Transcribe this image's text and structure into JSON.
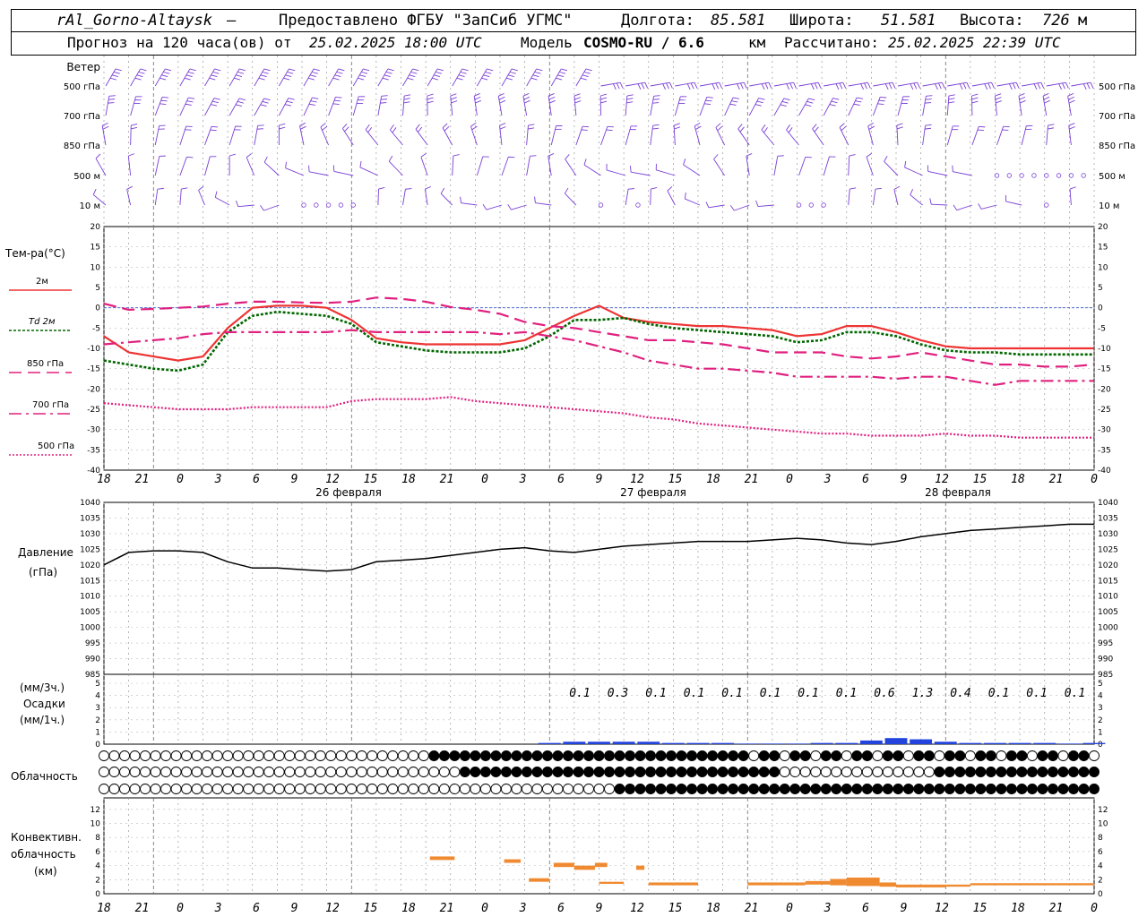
{
  "header": {
    "station": "rAl_Gorno-Altaysk",
    "sep": " — ",
    "provider": "Предоставлено ФГБУ \"ЗапСиб УГМС\"",
    "lon_label": "Долгота:",
    "lon": "85.581",
    "lat_label": "Широта:",
    "lat": "51.581",
    "alt_label": "Высота:",
    "alt": "726",
    "alt_unit": "м",
    "forecast_label": "Прогноз на 120 часа(ов) от",
    "run_time": "25.02.2025 18:00 UTC",
    "model_label": "Модель",
    "model": "COSMO-RU / 6.6",
    "model_unit": "км",
    "calc_label": "Рассчитано:",
    "calc_time": "25.02.2025 22:39 UTC"
  },
  "wind_panel": {
    "title": "Ветер",
    "levels": [
      "500 гПа",
      "700 гПа",
      "850 гПа",
      "500  м",
      "10   м"
    ]
  },
  "temp_panel": {
    "title": "Тем-ра(°C)",
    "legend": [
      "2м",
      "Td  2м",
      "850 гПа",
      "700 гПа",
      "500 гПа"
    ],
    "yticks": [
      "20",
      "15",
      "10",
      "5",
      "0",
      "-5",
      "-10",
      "-15",
      "-20",
      "-25",
      "-30",
      "-35",
      "-40"
    ]
  },
  "x_axis": {
    "hour_labels": [
      "18",
      "21",
      "0",
      "3",
      "6",
      "9",
      "12",
      "15",
      "18",
      "21",
      "0",
      "3",
      "6",
      "9",
      "12",
      "15",
      "18",
      "21",
      "0",
      "3",
      "6",
      "9",
      "12",
      "15",
      "18",
      "21",
      "0"
    ],
    "dates": [
      "26 февраля",
      "27 февраля",
      "28 февраля"
    ]
  },
  "pressure_panel": {
    "title": "Давление",
    "unit": "(гПа)",
    "yticks": [
      "1040",
      "1035",
      "1030",
      "1025",
      "1020",
      "1015",
      "1010",
      "1005",
      "1000",
      "995",
      "990",
      "985"
    ]
  },
  "precip_panel": {
    "unit_top": "(мм/3ч.)",
    "title": "Осадки",
    "unit_bottom": "(мм/1ч.)",
    "yticks": [
      "5",
      "4",
      "3",
      "2",
      "1",
      "0"
    ],
    "totals_3h": [
      "0.1",
      "0.3",
      "0.1",
      "0.1",
      "0.1",
      "0.1",
      "0.1",
      "0.1",
      "0.6",
      "1.3",
      "0.4",
      "0.1",
      "0.1",
      "0.1"
    ]
  },
  "cloud_panel": {
    "title": "Облачность"
  },
  "conv_panel": {
    "title_lines": [
      "Конвективн.",
      "облачность",
      "(км)"
    ],
    "yticks": [
      "12",
      "10",
      "8",
      "6",
      "4",
      "2",
      "0"
    ]
  },
  "chart_data": [
    {
      "type": "line",
      "title": "Тем-ра(°C)",
      "x_hours_since_start": [
        0,
        3,
        6,
        9,
        12,
        15,
        18,
        21,
        24,
        27,
        30,
        33,
        36,
        39,
        42,
        45,
        48,
        51,
        54,
        57,
        60,
        63,
        66,
        69,
        72,
        75,
        78,
        81,
        84,
        87,
        90,
        93,
        96,
        99,
        102,
        105,
        108,
        111,
        114,
        117,
        120
      ],
      "ylim": [
        -40,
        20
      ],
      "series": [
        {
          "name": "2м",
          "color": "#ee3333",
          "values": [
            -7,
            -11,
            -12,
            -13,
            -12,
            -5,
            0,
            0.5,
            0.5,
            0,
            -3,
            -7.5,
            -8.5,
            -9,
            -9,
            -9,
            -9,
            -8,
            -5,
            -2,
            0.5,
            -2.5,
            -3.5,
            -4,
            -4.5,
            -4.5,
            -5,
            -5.5,
            -7,
            -6.5,
            -4.5,
            -4.5,
            -6,
            -8,
            -9.5,
            -10,
            -10,
            -10,
            -10,
            -10,
            -10
          ]
        },
        {
          "name": "Td  2м",
          "color": "#006600",
          "values": [
            -13,
            -14,
            -15,
            -15.5,
            -14,
            -6,
            -2,
            -1,
            -1.5,
            -2,
            -4,
            -8.5,
            -9.5,
            -10.5,
            -11,
            -11,
            -11,
            -10,
            -7,
            -3,
            -3,
            -2.5,
            -4,
            -5,
            -5.5,
            -6,
            -6.5,
            -7,
            -8.5,
            -8,
            -6,
            -6,
            -7,
            -9,
            -10.5,
            -11,
            -11,
            -11.5,
            -11.5,
            -11.5,
            -11.5
          ]
        },
        {
          "name": "850 гПа",
          "color": "#e0207f",
          "values": [
            1,
            -0.5,
            -0.3,
            0,
            0.3,
            1,
            1.5,
            1.5,
            1.3,
            1.2,
            1.5,
            2.5,
            2.2,
            1.5,
            0.2,
            -0.5,
            -1.5,
            -3.5,
            -4.5,
            -5,
            -6,
            -7,
            -8,
            -8,
            -8.5,
            -9,
            -10,
            -11,
            -11,
            -11,
            -12,
            -12.5,
            -12,
            -11,
            -12,
            -13,
            -14,
            -14,
            -14.5,
            -14.5,
            -14
          ]
        },
        {
          "name": "700 гПа",
          "color": "#e0207f",
          "values": [
            -9,
            -8.5,
            -8,
            -7.5,
            -6.5,
            -6,
            -6,
            -6,
            -6,
            -6,
            -5.5,
            -6,
            -6,
            -6,
            -6,
            -6,
            -6.5,
            -6,
            -7,
            -8,
            -9.5,
            -11,
            -13,
            -14,
            -15,
            -15,
            -15.5,
            -16,
            -17,
            -17,
            -17,
            -17,
            -17.5,
            -17,
            -17,
            -18,
            -19,
            -18,
            -18,
            -18,
            -18
          ]
        },
        {
          "name": "500 гПа",
          "color": "#e0207f",
          "values": [
            -23.5,
            -24,
            -24.5,
            -25,
            -25,
            -25,
            -24.5,
            -24.5,
            -24.5,
            -24.5,
            -23,
            -22.5,
            -22.5,
            -22.5,
            -22,
            -23,
            -23.5,
            -24,
            -24.5,
            -25,
            -25.5,
            -26,
            -27,
            -27.5,
            -28.5,
            -29,
            -29.5,
            -30,
            -30.5,
            -31,
            -31,
            -31.5,
            -31.5,
            -31.5,
            -31,
            -31.5,
            -31.5,
            -32,
            -32,
            -32,
            -32
          ]
        }
      ]
    },
    {
      "type": "line",
      "title": "Давление",
      "ylim": [
        985,
        1040
      ],
      "x_hours_since_start": [
        0,
        3,
        6,
        9,
        12,
        15,
        18,
        21,
        24,
        27,
        30,
        33,
        36,
        39,
        42,
        45,
        48,
        51,
        54,
        57,
        60,
        63,
        66,
        69,
        72,
        75,
        78,
        81,
        84,
        87,
        90,
        93,
        96,
        99,
        102,
        105,
        108,
        111,
        114,
        117,
        120
      ],
      "values": [
        1020,
        1024,
        1024.5,
        1024.5,
        1024,
        1021,
        1019,
        1019,
        1018.5,
        1018,
        1018.5,
        1021,
        1021.5,
        1022,
        1023,
        1024,
        1025,
        1025.5,
        1024.5,
        1024,
        1025,
        1026,
        1026.5,
        1027,
        1027.5,
        1027.5,
        1027.5,
        1028,
        1028.5,
        1028,
        1027,
        1026.5,
        1027.5,
        1029,
        1030,
        1031,
        1031.5,
        1032,
        1032.5,
        1033,
        1033
      ]
    },
    {
      "type": "bar",
      "title": "Осадки",
      "ylim": [
        0,
        5
      ],
      "x_hours_since_start": [
        54,
        57,
        60,
        63,
        66,
        69,
        72,
        75,
        78,
        81,
        84,
        87,
        90,
        93,
        96,
        99,
        102,
        105,
        108,
        111,
        114,
        117,
        120
      ],
      "values": [
        0.1,
        0.2,
        0.2,
        0.2,
        0.2,
        0.1,
        0.1,
        0.1,
        0.05,
        0.05,
        0.05,
        0.1,
        0.1,
        0.3,
        0.5,
        0.4,
        0.2,
        0.1,
        0.1,
        0.1,
        0.1,
        0.05,
        0.1
      ]
    },
    {
      "type": "bar",
      "title": "Конвективн. облачность",
      "ylim": [
        0,
        13
      ],
      "bars_km": [
        {
          "h": [
            39.5,
            42.5
          ],
          "base": 4.8,
          "top": 5.3
        },
        {
          "h": [
            48.5,
            50.5
          ],
          "base": 4.4,
          "top": 4.9
        },
        {
          "h": [
            51.5,
            54
          ],
          "base": 1.7,
          "top": 2.2
        },
        {
          "h": [
            54.5,
            57
          ],
          "base": 3.8,
          "top": 4.4
        },
        {
          "h": [
            57,
            59.5
          ],
          "base": 3.4,
          "top": 4.0
        },
        {
          "h": [
            59.5,
            61
          ],
          "base": 3.8,
          "top": 4.4
        },
        {
          "h": [
            60,
            63
          ],
          "base": 1.4,
          "top": 1.7
        },
        {
          "h": [
            64.5,
            65.5
          ],
          "base": 3.4,
          "top": 4.0
        },
        {
          "h": [
            66,
            69
          ],
          "base": 1.2,
          "top": 1.6
        },
        {
          "h": [
            69,
            72
          ],
          "base": 1.2,
          "top": 1.6
        },
        {
          "h": [
            78,
            85
          ],
          "base": 1.2,
          "top": 1.6
        },
        {
          "h": [
            85,
            88
          ],
          "base": 1.3,
          "top": 1.8
        },
        {
          "h": [
            88,
            90
          ],
          "base": 1.2,
          "top": 2.1
        },
        {
          "h": [
            90,
            94
          ],
          "base": 1.1,
          "top": 2.3
        },
        {
          "h": [
            94,
            96
          ],
          "base": 1.0,
          "top": 1.6
        },
        {
          "h": [
            96,
            102
          ],
          "base": 0.9,
          "top": 1.3
        },
        {
          "h": [
            102,
            105
          ],
          "base": 1.0,
          "top": 1.3
        },
        {
          "h": [
            105,
            110
          ],
          "base": 1.2,
          "top": 1.5
        },
        {
          "h": [
            110,
            120
          ],
          "base": 1.2,
          "top": 1.5
        }
      ]
    }
  ],
  "colors": {
    "wind": "#7a3fd6",
    "t2m": "#ee3333",
    "td": "#006600",
    "upper": "#e0207f",
    "precip": "#2244dd",
    "conv": "#f08a30",
    "zero_line": "#3355cc"
  }
}
